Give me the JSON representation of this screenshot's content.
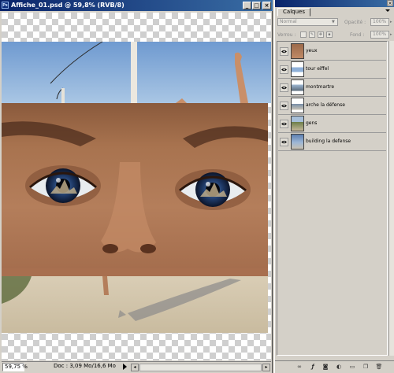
{
  "document": {
    "title": "Affiche_01.psd @ 59,8% (RVB/8)",
    "zoom": "59,75 %",
    "doc_info": "Doc : 3,09 Mo/16,6 Mo"
  },
  "palette": {
    "tab": "Calques",
    "blend_mode": "Normal",
    "opacity_label": "Opacité :",
    "opacity_value": "100%",
    "lock_label": "Verrou :",
    "fill_label": "Fond :",
    "fill_value": "100%",
    "layers": [
      {
        "name": "yeux"
      },
      {
        "name": "tour eiffel"
      },
      {
        "name": "montmartre"
      },
      {
        "name": "arche la défense"
      },
      {
        "name": "gens"
      },
      {
        "name": "building la defense"
      }
    ]
  },
  "icons": {
    "eye": "eye-icon",
    "link": "link-icon",
    "style": "layer-style-icon",
    "mask": "mask-icon",
    "adjust": "adjustment-icon",
    "folder": "folder-icon",
    "new": "new-layer-icon",
    "trash": "trash-icon"
  }
}
